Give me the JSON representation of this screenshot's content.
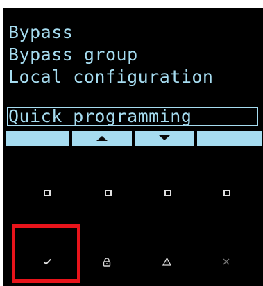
{
  "lcd": {
    "lines": [
      "Bypass",
      "Bypass group",
      "Local configuration",
      "Quick programming"
    ],
    "selected_index": 3,
    "text_color": "#a6dcf0"
  },
  "softkeys": [
    {
      "icon": "",
      "name": "softkey-1"
    },
    {
      "icon": "triangle-up-icon",
      "name": "softkey-up"
    },
    {
      "icon": "triangle-down-icon",
      "name": "softkey-down"
    },
    {
      "icon": "",
      "name": "softkey-4"
    }
  ],
  "function_buttons": [
    "square-icon",
    "square-icon",
    "square-icon",
    "square-icon"
  ],
  "actions": {
    "ok": "✓",
    "lock": "🔒",
    "warning": "⚠",
    "cancel": "✕"
  },
  "highlight_color": "#e8141b"
}
